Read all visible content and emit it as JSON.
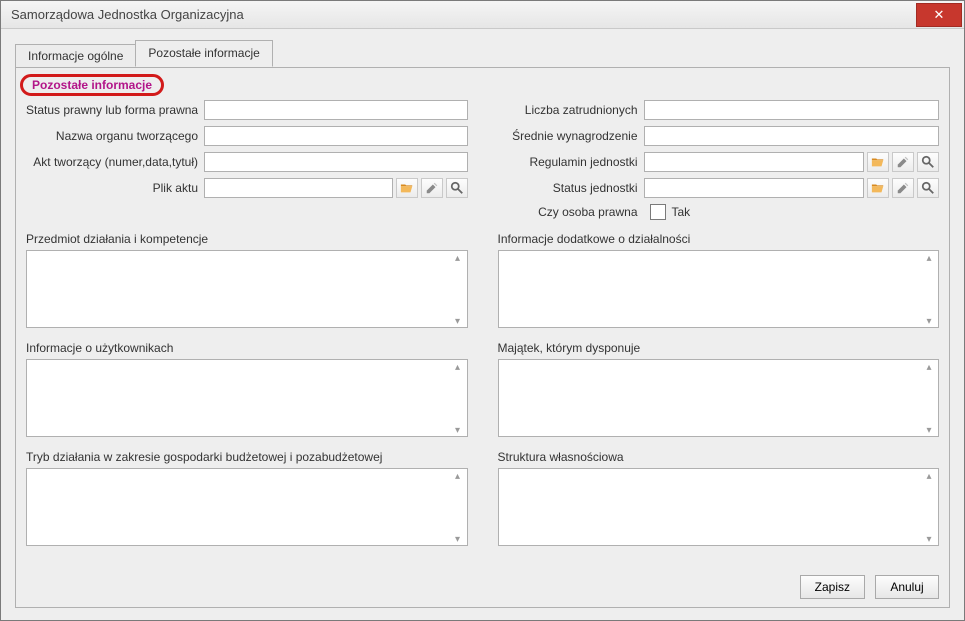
{
  "window": {
    "title": "Samorządowa Jednostka Organizacyjna"
  },
  "tabs": [
    {
      "label": "Informacje ogólne"
    },
    {
      "label": "Pozostałe informacje"
    }
  ],
  "group": {
    "title": "Pozostałe informacje"
  },
  "left": {
    "status_prawny_label": "Status prawny lub forma prawna",
    "status_prawny_value": "",
    "nazwa_organu_label": "Nazwa organu tworzącego",
    "nazwa_organu_value": "",
    "akt_label": "Akt tworzący (numer,data,tytuł)",
    "akt_value": "",
    "plik_aktu_label": "Plik aktu",
    "plik_aktu_value": ""
  },
  "right": {
    "liczba_label": "Liczba zatrudnionych",
    "liczba_value": "",
    "srednie_label": "Średnie wynagrodzenie",
    "srednie_value": "",
    "regulamin_label": "Regulamin jednostki",
    "regulamin_value": "",
    "status_label": "Status jednostki",
    "status_value": "",
    "czy_osoba_label": "Czy osoba prawna",
    "czy_osoba_check": "Tak"
  },
  "textareas": {
    "przedmiot_label": "Przedmiot działania i kompetencje",
    "przedmiot_value": "",
    "info_dod_label": "Informacje dodatkowe o działalności",
    "info_dod_value": "",
    "info_uzyt_label": "Informacje o użytkownikach",
    "info_uzyt_value": "",
    "majatek_label": "Majątek, którym dysponuje",
    "majatek_value": "",
    "tryb_label": "Tryb działania w zakresie gospodarki budżetowej i pozabudżetowej",
    "tryb_value": "",
    "struktura_label": "Struktura własnościowa",
    "struktura_value": ""
  },
  "buttons": {
    "save": "Zapisz",
    "cancel": "Anuluj"
  },
  "icons": {
    "folder": "folder-open-icon",
    "edit": "pencil-icon",
    "search": "magnifier-icon"
  }
}
